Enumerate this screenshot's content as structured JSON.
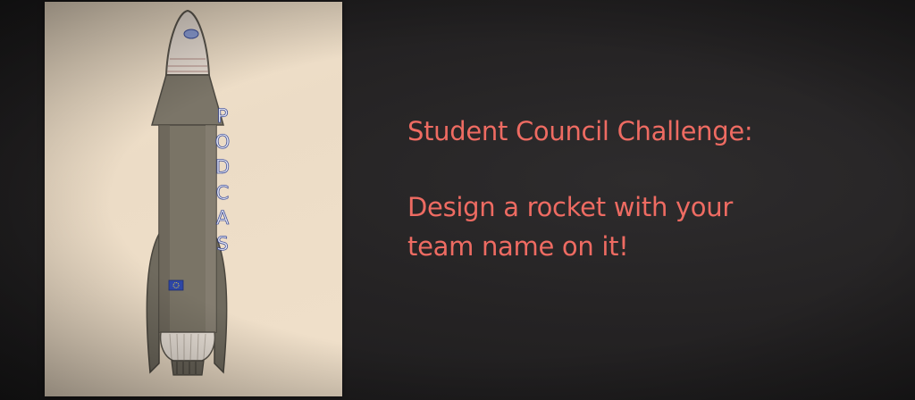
{
  "rocket": {
    "letters": [
      "P",
      "O",
      "D",
      "C",
      "A",
      "S"
    ],
    "flag": "eu-flag-icon"
  },
  "slide": {
    "title": "Student Council Challenge:",
    "body_line_1": "Design a rocket with your",
    "body_line_2": "team name on it!"
  },
  "colors": {
    "background": "#1f1e1f",
    "text": "#ee6b62",
    "paper": "#f0e0ca",
    "rocket_body": "#7a7466"
  }
}
